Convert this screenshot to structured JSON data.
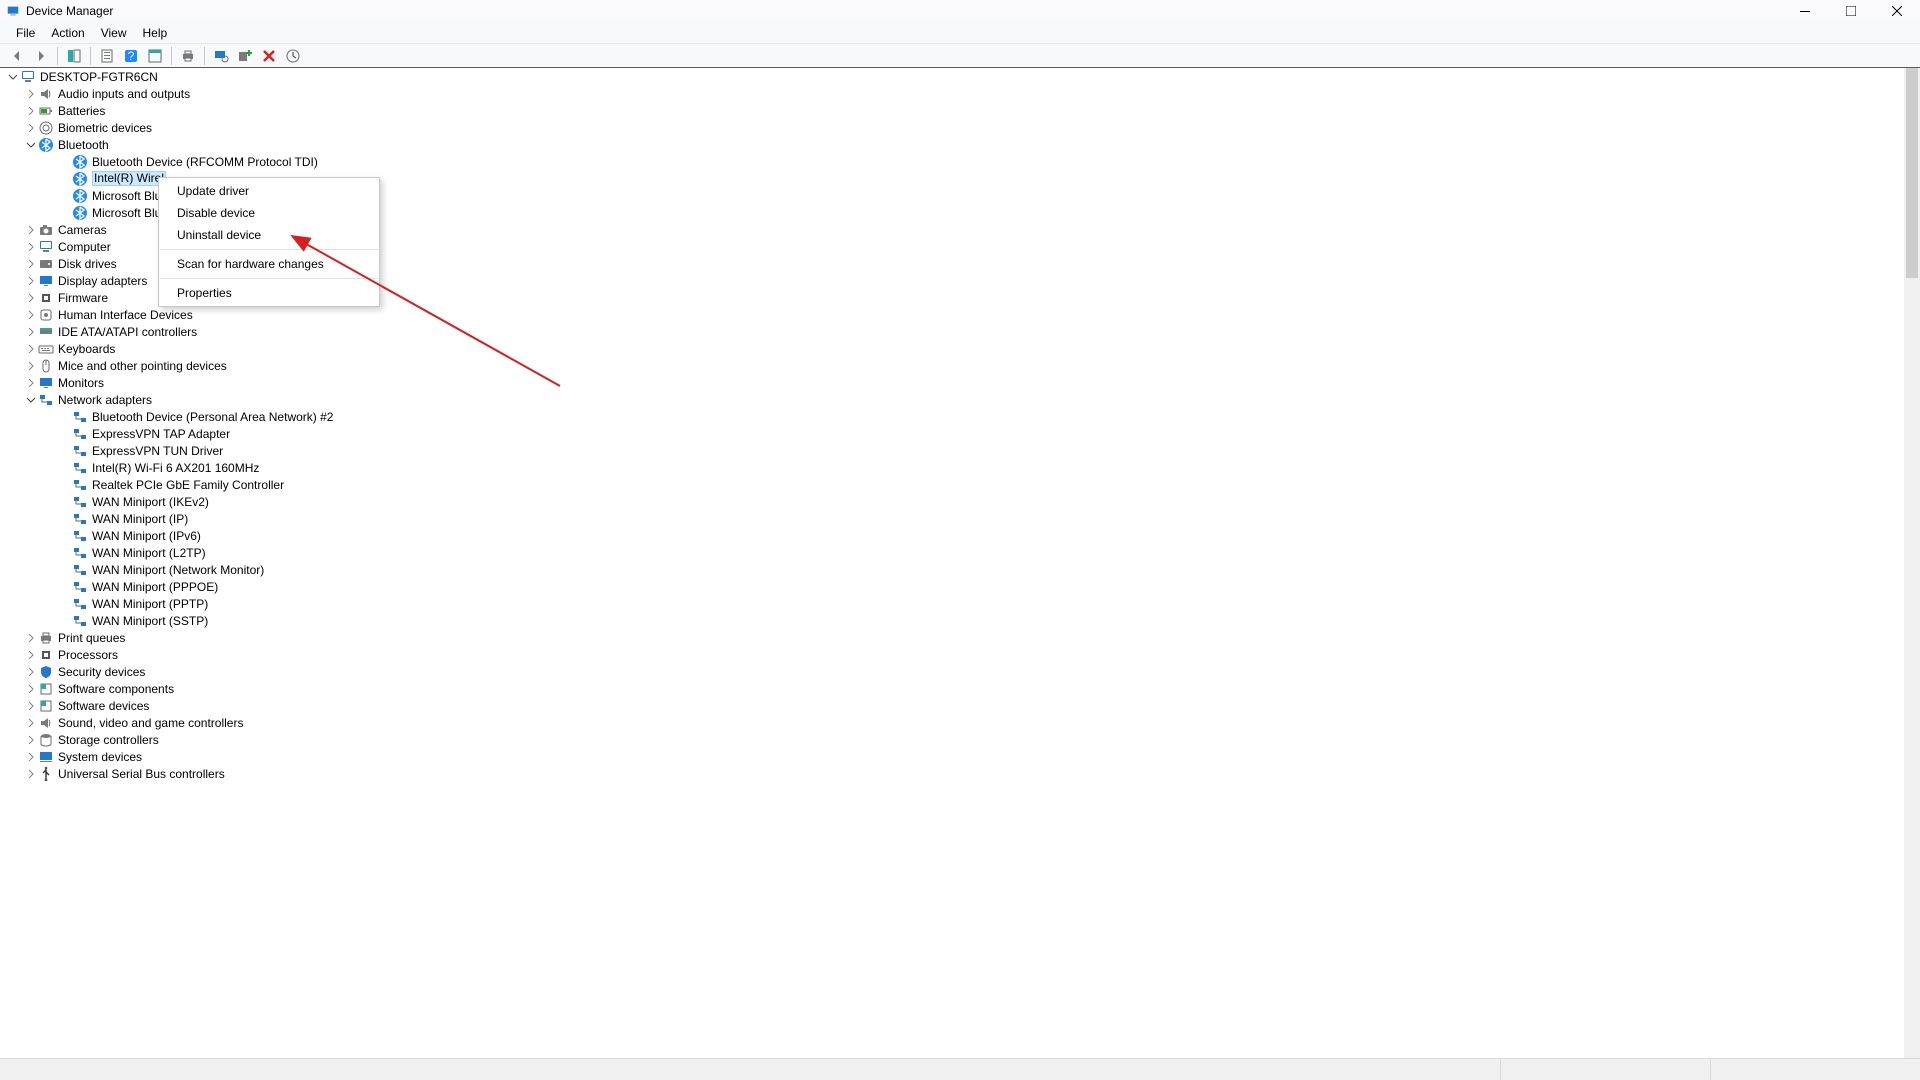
{
  "window": {
    "title": "Device Manager"
  },
  "menubar": [
    "File",
    "Action",
    "View",
    "Help"
  ],
  "context_menu": {
    "groups": [
      [
        "Update driver",
        "Disable device",
        "Uninstall device"
      ],
      [
        "Scan for hardware changes"
      ],
      [
        "Properties"
      ]
    ],
    "target_item": "Uninstall device"
  },
  "tree": {
    "root": {
      "label": "DESKTOP-FGTR6CN",
      "icon": "computer-icon",
      "expanded": true
    },
    "top": [
      {
        "label": "Audio inputs and outputs",
        "icon": "speaker-icon",
        "expander": "collapsed"
      },
      {
        "label": "Batteries",
        "icon": "battery-icon",
        "expander": "collapsed"
      },
      {
        "label": "Biometric devices",
        "icon": "fingerprint-icon",
        "expander": "collapsed"
      },
      {
        "label": "Bluetooth",
        "icon": "bluetooth-icon",
        "expander": "expanded",
        "children": [
          {
            "label": "Bluetooth Device (RFCOMM Protocol TDI)",
            "icon": "bluetooth-icon"
          },
          {
            "label": "Intel(R) Wireless Bluetooth(R)",
            "icon": "bluetooth-icon",
            "selected": true,
            "truncate_at": 14
          },
          {
            "label": "Microsoft Bluetooth Enumerator",
            "icon": "bluetooth-icon",
            "truncate_at": 14
          },
          {
            "label": "Microsoft Bluetooth LE Enumerator",
            "icon": "bluetooth-icon",
            "truncate_at": 14
          }
        ]
      },
      {
        "label": "Cameras",
        "icon": "camera-icon",
        "expander": "collapsed"
      },
      {
        "label": "Computer",
        "icon": "computer-icon",
        "expander": "collapsed"
      },
      {
        "label": "Disk drives",
        "icon": "disk-icon",
        "expander": "collapsed"
      },
      {
        "label": "Display adapters",
        "icon": "display-icon",
        "expander": "collapsed"
      },
      {
        "label": "Firmware",
        "icon": "chip-icon",
        "expander": "collapsed"
      },
      {
        "label": "Human Interface Devices",
        "icon": "hid-icon",
        "expander": "collapsed"
      },
      {
        "label": "IDE ATA/ATAPI controllers",
        "icon": "ide-icon",
        "expander": "collapsed"
      },
      {
        "label": "Keyboards",
        "icon": "keyboard-icon",
        "expander": "collapsed"
      },
      {
        "label": "Mice and other pointing devices",
        "icon": "mouse-icon",
        "expander": "collapsed"
      },
      {
        "label": "Monitors",
        "icon": "display-icon",
        "expander": "collapsed"
      },
      {
        "label": "Network adapters",
        "icon": "network-icon",
        "expander": "expanded",
        "children": [
          {
            "label": "Bluetooth Device (Personal Area Network) #2",
            "icon": "network-icon"
          },
          {
            "label": "ExpressVPN TAP Adapter",
            "icon": "network-icon"
          },
          {
            "label": "ExpressVPN TUN Driver",
            "icon": "network-icon"
          },
          {
            "label": "Intel(R) Wi-Fi 6 AX201 160MHz",
            "icon": "network-icon"
          },
          {
            "label": "Realtek PCIe GbE Family Controller",
            "icon": "network-icon"
          },
          {
            "label": "WAN Miniport (IKEv2)",
            "icon": "network-icon"
          },
          {
            "label": "WAN Miniport (IP)",
            "icon": "network-icon"
          },
          {
            "label": "WAN Miniport (IPv6)",
            "icon": "network-icon"
          },
          {
            "label": "WAN Miniport (L2TP)",
            "icon": "network-icon"
          },
          {
            "label": "WAN Miniport (Network Monitor)",
            "icon": "network-icon"
          },
          {
            "label": "WAN Miniport (PPPOE)",
            "icon": "network-icon"
          },
          {
            "label": "WAN Miniport (PPTP)",
            "icon": "network-icon"
          },
          {
            "label": "WAN Miniport (SSTP)",
            "icon": "network-icon"
          }
        ]
      },
      {
        "label": "Print queues",
        "icon": "printer-icon",
        "expander": "collapsed"
      },
      {
        "label": "Processors",
        "icon": "chip-icon",
        "expander": "collapsed"
      },
      {
        "label": "Security devices",
        "icon": "shield-icon",
        "expander": "collapsed"
      },
      {
        "label": "Software components",
        "icon": "component-icon",
        "expander": "collapsed"
      },
      {
        "label": "Software devices",
        "icon": "component-icon",
        "expander": "collapsed"
      },
      {
        "label": "Sound, video and game controllers",
        "icon": "speaker-icon",
        "expander": "collapsed"
      },
      {
        "label": "Storage controllers",
        "icon": "storage-icon",
        "expander": "collapsed"
      },
      {
        "label": "System devices",
        "icon": "system-icon",
        "expander": "collapsed"
      },
      {
        "label": "Universal Serial Bus controllers",
        "icon": "usb-icon",
        "expander": "collapsed"
      }
    ]
  },
  "toolbar_icons": [
    "back-icon",
    "forward-icon",
    "|",
    "show-hide-console-tree-icon",
    "|",
    "properties-icon",
    "help-icon",
    "action-icon",
    "|",
    "print-icon",
    "|",
    "scan-hardware-icon",
    "add-legacy-hardware-icon",
    "remove-device-icon",
    "update-driver-icon"
  ]
}
